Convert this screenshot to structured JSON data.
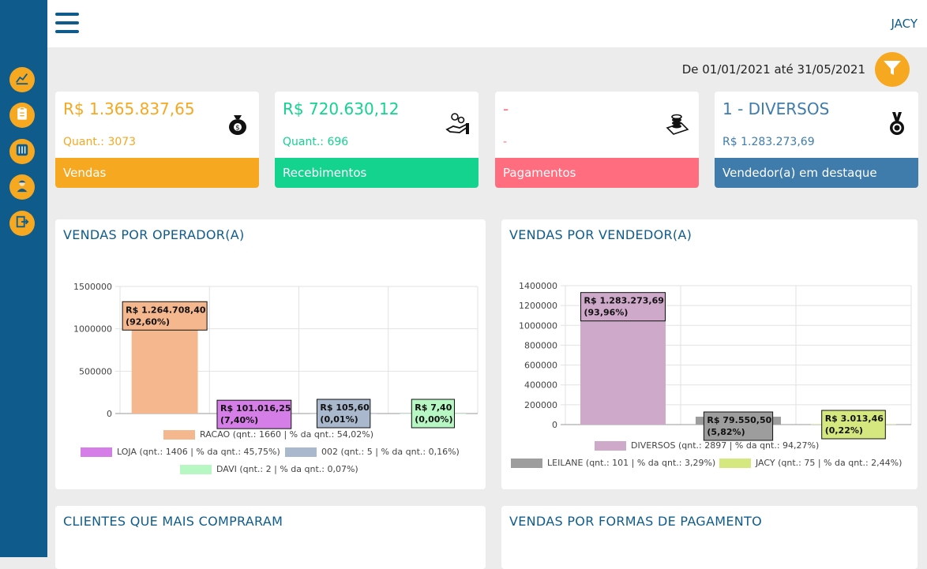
{
  "sidebar": {
    "items": [
      {
        "icon": "chart-line-icon"
      },
      {
        "icon": "clipboard-icon"
      },
      {
        "icon": "sliders-icon"
      },
      {
        "icon": "user-worker-icon"
      },
      {
        "icon": "logout-icon"
      }
    ]
  },
  "header": {
    "user": "JACY",
    "menu_icon": "hamburger-icon"
  },
  "filter": {
    "date_range": "De 01/01/2021 até 31/05/2021",
    "icon": "funnel-icon"
  },
  "cards": [
    {
      "value": "R$ 1.365.837,65",
      "sub": "Quant.: 3073",
      "footer": "Vendas",
      "color": "#f6a821",
      "icon": "money-bag-icon"
    },
    {
      "value": "R$ 720.630,12",
      "sub": "Quant.: 696",
      "footer": "Recebimentos",
      "color": "#14d38f",
      "icon": "hand-coins-icon"
    },
    {
      "value": "-",
      "sub": "-",
      "footer": "Pagamentos",
      "color": "#ff6d7e",
      "icon": "coins-stack-icon"
    },
    {
      "value": "1 - DIVERSOS",
      "sub": "R$ 1.283.273,69",
      "footer": "Vendedor(a) em destaque",
      "color": "#3f7cac",
      "icon": "medal-icon"
    }
  ],
  "panels": {
    "operador_title": "VENDAS POR OPERADOR(A)",
    "vendedor_title": "VENDAS POR VENDEDOR(A)",
    "clientes_title": "CLIENTES QUE MAIS COMPRARAM",
    "formas_title": "VENDAS POR FORMAS DE PAGAMENTO"
  },
  "chart_data": [
    {
      "type": "bar",
      "title": "VENDAS POR OPERADOR(A)",
      "categories": [
        "RACAO",
        "LOJA",
        "002",
        "DAVI"
      ],
      "values": [
        1264708.4,
        101016.25,
        105.6,
        7.4
      ],
      "colors": [
        "#f5b78e",
        "#d57ee8",
        "#a9b8cc",
        "#b7f7c3"
      ],
      "data_labels": [
        [
          "R$ 1.264.708,40",
          "(92,60%)"
        ],
        [
          "R$ 101.016,25",
          "(7,40%)"
        ],
        [
          "R$ 105,60",
          "(0,01%)"
        ],
        [
          "R$ 7,40",
          "(0,00%)"
        ]
      ],
      "legend": [
        "RACAO (qnt.: 1660 | % da qnt.: 54,02%)",
        "LOJA (qnt.: 1406 | % da qnt.: 45,75%)",
        "002 (qnt.: 5 | % da qnt.: 0,16%)",
        "DAVI (qnt.: 2 | % da qnt.: 0,07%)"
      ],
      "ylim": [
        0,
        1500000
      ],
      "yticks": [
        "0",
        "500000",
        "1000000",
        "1500000"
      ],
      "grid": true
    },
    {
      "type": "bar",
      "title": "VENDAS POR VENDEDOR(A)",
      "categories": [
        "DIVERSOS",
        "LEILANE",
        "JACY"
      ],
      "values": [
        1283273.69,
        79550.5,
        3013.46
      ],
      "colors": [
        "#cea9c9",
        "#9d9d9d",
        "#d4e87f"
      ],
      "data_labels": [
        [
          "R$ 1.283.273,69",
          "(93,96%)"
        ],
        [
          "R$ 79.550,50",
          "(5,82%)"
        ],
        [
          "R$ 3.013,46",
          "(0,22%)"
        ]
      ],
      "legend": [
        "DIVERSOS (qnt.: 2897 | % da qnt.: 94,27%)",
        "LEILANE (qnt.: 101 | % da qnt.: 3,29%)",
        "JACY (qnt.: 75 | % da qnt.: 2,44%)"
      ],
      "ylim": [
        0,
        1400000
      ],
      "yticks": [
        "0",
        "200000",
        "400000",
        "600000",
        "800000",
        "1000000",
        "1200000",
        "1400000"
      ],
      "grid": true
    }
  ]
}
